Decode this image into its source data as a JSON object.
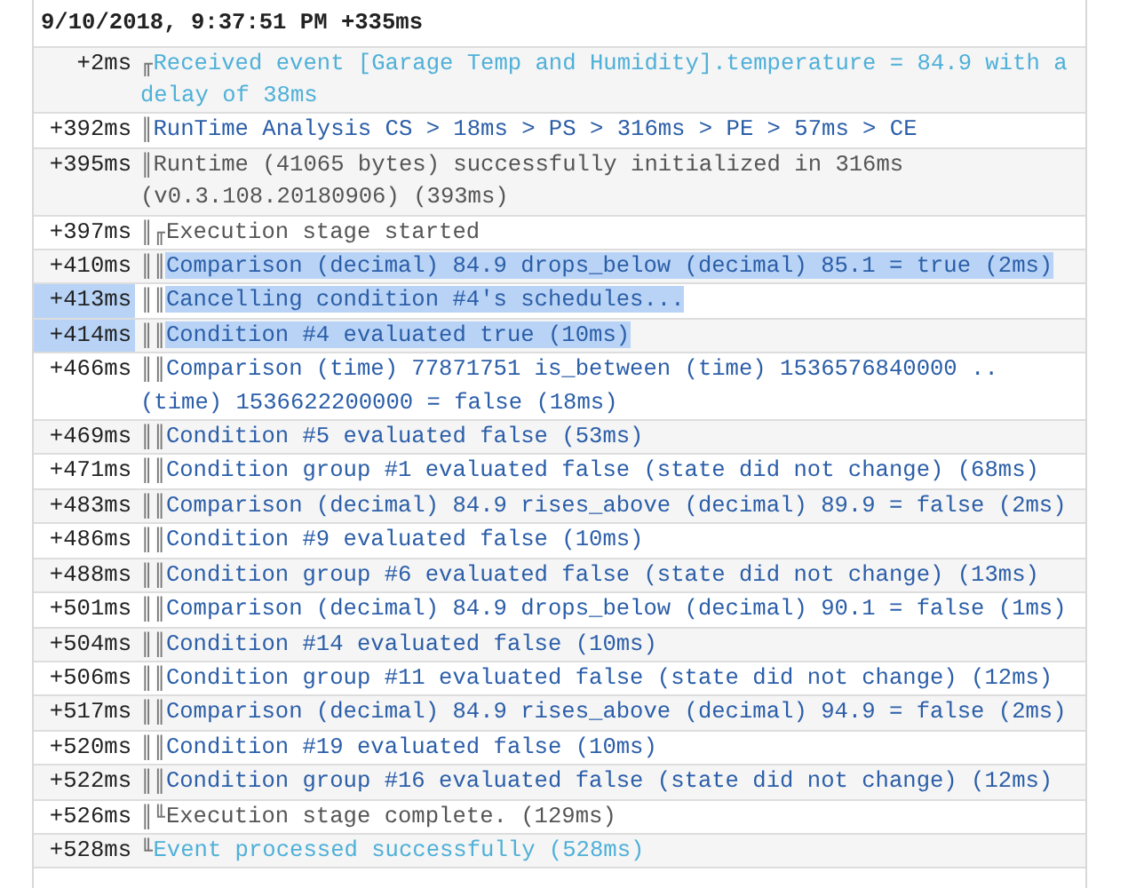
{
  "log": {
    "title": "9/10/2018, 9:37:51 PM +335ms",
    "rows": [
      {
        "time": "+2ms",
        "prefix": "╓",
        "message": "Received event [Garage Temp and Humidity].temperature = 84.9 with a delay of 38ms",
        "kind": "event",
        "time_selected": false,
        "message_selected": false
      },
      {
        "time": "+392ms",
        "prefix": "║",
        "message": "RunTime Analysis CS > 18ms > PS > 316ms > PE > 57ms > CE",
        "kind": "info",
        "time_selected": false,
        "message_selected": false
      },
      {
        "time": "+395ms",
        "prefix": "║",
        "message": "Runtime (41065 bytes) successfully initialized in 316ms (v0.3.108.20180906) (393ms)",
        "kind": "plain",
        "time_selected": false,
        "message_selected": false
      },
      {
        "time": "+397ms",
        "prefix": "║╓",
        "message": "Execution stage started",
        "kind": "plain",
        "time_selected": false,
        "message_selected": false
      },
      {
        "time": "+410ms",
        "prefix": "║║",
        "message": "Comparison (decimal) 84.9 drops_below (decimal) 85.1 = true (2ms)",
        "kind": "info",
        "time_selected": false,
        "message_selected": true
      },
      {
        "time": "+413ms",
        "prefix": "║║",
        "message": "Cancelling condition #4's schedules...",
        "kind": "info",
        "time_selected": true,
        "message_selected": true
      },
      {
        "time": "+414ms",
        "prefix": "║║",
        "message": "Condition #4 evaluated true (10ms)",
        "kind": "info",
        "time_selected": true,
        "message_selected": true
      },
      {
        "time": "+466ms",
        "prefix": "║║",
        "message": "Comparison (time) 77871751 is_between (time) 1536576840000 .. (time) 1536622200000 = false (18ms)",
        "kind": "info",
        "time_selected": false,
        "message_selected": false
      },
      {
        "time": "+469ms",
        "prefix": "║║",
        "message": "Condition #5 evaluated false (53ms)",
        "kind": "info",
        "time_selected": false,
        "message_selected": false
      },
      {
        "time": "+471ms",
        "prefix": "║║",
        "message": "Condition group #1 evaluated false (state did not change) (68ms)",
        "kind": "info",
        "time_selected": false,
        "message_selected": false
      },
      {
        "time": "+483ms",
        "prefix": "║║",
        "message": "Comparison (decimal) 84.9 rises_above (decimal) 89.9 = false (2ms)",
        "kind": "info",
        "time_selected": false,
        "message_selected": false
      },
      {
        "time": "+486ms",
        "prefix": "║║",
        "message": "Condition #9 evaluated false (10ms)",
        "kind": "info",
        "time_selected": false,
        "message_selected": false
      },
      {
        "time": "+488ms",
        "prefix": "║║",
        "message": "Condition group #6 evaluated false (state did not change) (13ms)",
        "kind": "info",
        "time_selected": false,
        "message_selected": false
      },
      {
        "time": "+501ms",
        "prefix": "║║",
        "message": "Comparison (decimal) 84.9 drops_below (decimal) 90.1 = false (1ms)",
        "kind": "info",
        "time_selected": false,
        "message_selected": false
      },
      {
        "time": "+504ms",
        "prefix": "║║",
        "message": "Condition #14 evaluated false (10ms)",
        "kind": "info",
        "time_selected": false,
        "message_selected": false
      },
      {
        "time": "+506ms",
        "prefix": "║║",
        "message": "Condition group #11 evaluated false (state did not change) (12ms)",
        "kind": "info",
        "time_selected": false,
        "message_selected": false
      },
      {
        "time": "+517ms",
        "prefix": "║║",
        "message": "Comparison (decimal) 84.9 rises_above (decimal) 94.9 = false (2ms)",
        "kind": "info",
        "time_selected": false,
        "message_selected": false
      },
      {
        "time": "+520ms",
        "prefix": "║║",
        "message": "Condition #19 evaluated false (10ms)",
        "kind": "info",
        "time_selected": false,
        "message_selected": false
      },
      {
        "time": "+522ms",
        "prefix": "║║",
        "message": "Condition group #16 evaluated false (state did not change) (12ms)",
        "kind": "info",
        "time_selected": false,
        "message_selected": false
      },
      {
        "time": "+526ms",
        "prefix": "║╙",
        "message": "Execution stage complete. (129ms)",
        "kind": "plain",
        "time_selected": false,
        "message_selected": false
      },
      {
        "time": "+528ms",
        "prefix": "╙",
        "message": "Event processed successfully (528ms)",
        "kind": "event",
        "time_selected": false,
        "message_selected": false
      }
    ]
  }
}
